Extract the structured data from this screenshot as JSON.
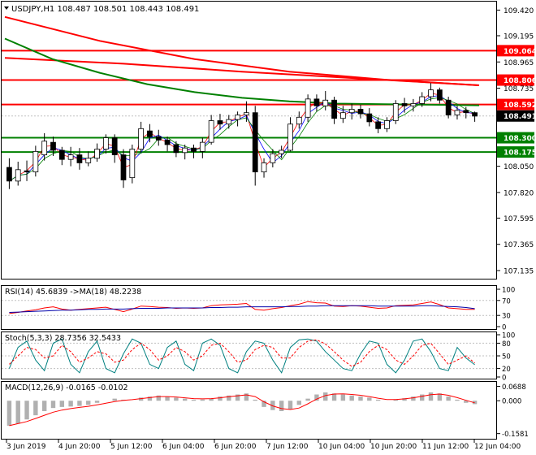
{
  "chart_data": {
    "type": "candlestick",
    "symbol_header": "USDJPY,H1  108.487 108.501 108.443 108.491",
    "ohlc_open": 108.487,
    "ohlc_high": 108.501,
    "ohlc_low": 108.443,
    "ohlc_close": 108.491,
    "current_price": "108.491",
    "x_tick_labels": [
      "3 Jun 2019",
      "4 Jun 20:00",
      "5 Jun 12:00",
      "6 Jun 04:00",
      "6 Jun 20:00",
      "7 Jun 12:00",
      "10 Jun 04:00",
      "10 Jun 20:00",
      "11 Jun 12:00",
      "12 Jun 04:00"
    ],
    "main": {
      "ylim": [
        107.085,
        109.48
      ],
      "y_ticks": [
        "109.420",
        "109.195",
        "108.965",
        "108.735",
        "108.510",
        "108.280",
        "108.050",
        "107.820",
        "107.595",
        "107.365",
        "107.135"
      ],
      "levels": [
        {
          "price": 109.064,
          "label": "109.064",
          "color": "#ff0000"
        },
        {
          "price": 108.806,
          "label": "108.806",
          "color": "#ff0000"
        },
        {
          "price": 108.592,
          "label": "108.592",
          "color": "#ff0000"
        },
        {
          "price": 108.3,
          "label": "108.300",
          "color": "#008000"
        },
        {
          "price": 108.175,
          "label": "108.175",
          "color": "#008000"
        }
      ],
      "trend_lines": [
        {
          "name": "red-ma-upper",
          "color": "#ff0000",
          "x": [
            0,
            0.2,
            0.4,
            0.6,
            0.8,
            1.0
          ],
          "y": [
            109.36,
            109.15,
            108.99,
            108.88,
            108.81,
            108.76
          ]
        },
        {
          "name": "red-ma-lower",
          "color": "#ff0000",
          "x": [
            0,
            0.25,
            0.5,
            0.75,
            1.0
          ],
          "y": [
            109.0,
            108.95,
            108.88,
            108.82,
            108.76
          ]
        },
        {
          "name": "green-ma",
          "color": "#008000",
          "x": [
            0,
            0.1,
            0.2,
            0.3,
            0.4,
            0.5,
            0.6,
            0.7,
            0.8,
            0.9,
            1.0
          ],
          "y": [
            109.17,
            108.99,
            108.87,
            108.77,
            108.7,
            108.65,
            108.62,
            108.6,
            108.595,
            108.59,
            108.585
          ]
        }
      ],
      "candles_ohlc": [
        [
          108.04,
          108.12,
          107.85,
          107.92
        ],
        [
          107.92,
          108.09,
          107.88,
          108.02
        ],
        [
          108.01,
          108.1,
          107.92,
          108.0
        ],
        [
          108.0,
          108.23,
          107.96,
          108.18
        ],
        [
          108.15,
          108.34,
          108.1,
          108.27
        ],
        [
          108.26,
          108.31,
          108.14,
          108.19
        ],
        [
          108.19,
          108.22,
          108.06,
          108.11
        ],
        [
          108.11,
          108.22,
          108.05,
          108.15
        ],
        [
          108.15,
          108.21,
          108.02,
          108.08
        ],
        [
          108.08,
          108.18,
          108.05,
          108.12
        ],
        [
          108.12,
          108.25,
          108.09,
          108.2
        ],
        [
          108.2,
          108.33,
          108.16,
          108.3
        ],
        [
          108.3,
          108.33,
          108.08,
          108.15
        ],
        [
          108.15,
          108.2,
          107.86,
          107.93
        ],
        [
          107.95,
          108.24,
          107.9,
          108.2
        ],
        [
          108.2,
          108.44,
          108.17,
          108.38
        ],
        [
          108.36,
          108.42,
          108.26,
          108.31
        ],
        [
          108.31,
          108.37,
          108.23,
          108.28
        ],
        [
          108.28,
          108.31,
          108.18,
          108.24
        ],
        [
          108.24,
          108.27,
          108.13,
          108.17
        ],
        [
          108.17,
          108.24,
          108.11,
          108.21
        ],
        [
          108.21,
          108.24,
          108.12,
          108.18
        ],
        [
          108.18,
          108.3,
          108.12,
          108.26
        ],
        [
          108.26,
          108.5,
          108.24,
          108.45
        ],
        [
          108.45,
          108.51,
          108.37,
          108.42
        ],
        [
          108.42,
          108.5,
          108.38,
          108.46
        ],
        [
          108.46,
          108.53,
          108.4,
          108.5
        ],
        [
          108.5,
          108.62,
          108.44,
          108.52
        ],
        [
          108.52,
          108.58,
          107.88,
          108.0
        ],
        [
          108.0,
          108.12,
          107.95,
          108.08
        ],
        [
          108.08,
          108.2,
          108.04,
          108.16
        ],
        [
          108.16,
          108.23,
          108.12,
          108.19
        ],
        [
          108.19,
          108.48,
          108.18,
          108.42
        ],
        [
          108.42,
          108.53,
          108.38,
          108.48
        ],
        [
          108.48,
          108.68,
          108.44,
          108.64
        ],
        [
          108.64,
          108.68,
          108.53,
          108.58
        ],
        [
          108.58,
          108.71,
          108.54,
          108.63
        ],
        [
          108.63,
          108.66,
          108.42,
          108.47
        ],
        [
          108.47,
          108.58,
          108.43,
          108.52
        ],
        [
          108.52,
          108.6,
          108.46,
          108.55
        ],
        [
          108.55,
          108.59,
          108.47,
          108.51
        ],
        [
          108.51,
          108.56,
          108.4,
          108.44
        ],
        [
          108.44,
          108.48,
          108.34,
          108.38
        ],
        [
          108.38,
          108.48,
          108.35,
          108.45
        ],
        [
          108.45,
          108.63,
          108.42,
          108.6
        ],
        [
          108.6,
          108.65,
          108.52,
          108.58
        ],
        [
          108.58,
          108.64,
          108.53,
          108.6
        ],
        [
          108.6,
          108.7,
          108.57,
          108.66
        ],
        [
          108.66,
          108.78,
          108.62,
          108.72
        ],
        [
          108.72,
          108.74,
          108.6,
          108.63
        ],
        [
          108.63,
          108.66,
          108.47,
          108.5
        ],
        [
          108.5,
          108.58,
          108.46,
          108.54
        ],
        [
          108.54,
          108.57,
          108.47,
          108.52
        ],
        [
          108.52,
          108.53,
          108.44,
          108.49
        ]
      ]
    },
    "rsi": {
      "label": "RSI(14) 45.6839  ->MA(18) 48.2238",
      "ylim": [
        0,
        100
      ],
      "y_ticks": [
        "100",
        "70",
        "30",
        "0"
      ],
      "rsi_values": [
        35,
        38,
        42,
        45,
        50,
        53,
        47,
        44,
        46,
        48,
        50,
        52,
        46,
        40,
        47,
        55,
        54,
        52,
        51,
        49,
        50,
        49,
        50,
        56,
        58,
        59,
        60,
        62,
        46,
        44,
        48,
        51,
        56,
        60,
        67,
        64,
        63,
        55,
        54,
        56,
        55,
        52,
        49,
        50,
        56,
        57,
        58,
        62,
        66,
        59,
        50,
        48,
        46,
        46
      ],
      "ma_values": [
        38,
        39,
        40,
        41,
        42,
        43,
        44,
        44,
        45,
        46,
        46,
        47,
        47,
        47,
        48,
        49,
        49,
        49,
        50,
        50,
        50,
        50,
        50,
        51,
        51,
        52,
        52,
        53,
        53,
        53,
        53,
        53,
        54,
        54,
        55,
        55,
        56,
        56,
        56,
        56,
        56,
        56,
        55,
        55,
        55,
        55,
        55,
        56,
        56,
        55,
        54,
        53,
        51,
        48
      ]
    },
    "stochastic": {
      "label": "Stoch(5,3,3) 28.7356 32.5433",
      "ylim": [
        0,
        100
      ],
      "y_ticks": [
        "100",
        "80",
        "50",
        "20",
        "0"
      ],
      "k_values": [
        20,
        70,
        85,
        40,
        15,
        80,
        90,
        30,
        10,
        60,
        85,
        20,
        10,
        55,
        90,
        80,
        30,
        20,
        70,
        85,
        30,
        15,
        80,
        90,
        75,
        20,
        10,
        60,
        85,
        80,
        40,
        10,
        70,
        88,
        90,
        85,
        60,
        40,
        20,
        15,
        55,
        85,
        80,
        30,
        10,
        40,
        85,
        90,
        60,
        20,
        15,
        70,
        45,
        29
      ],
      "d_values": [
        30,
        50,
        70,
        65,
        45,
        50,
        75,
        60,
        35,
        45,
        60,
        55,
        35,
        40,
        65,
        80,
        65,
        40,
        50,
        70,
        60,
        40,
        50,
        75,
        80,
        60,
        35,
        40,
        65,
        75,
        70,
        45,
        45,
        70,
        85,
        88,
        78,
        60,
        40,
        25,
        35,
        60,
        75,
        65,
        40,
        30,
        50,
        75,
        80,
        55,
        30,
        40,
        50,
        33
      ]
    },
    "macd": {
      "label": "MACD(12,26,9) -0.0165 -0.0102",
      "ylim": [
        -0.175,
        0.075
      ],
      "y_ticks": [
        "0.0688",
        "0.000",
        "-0.1581"
      ],
      "histogram": [
        -0.12,
        -0.11,
        -0.09,
        -0.07,
        -0.05,
        -0.035,
        -0.03,
        -0.028,
        -0.025,
        -0.02,
        -0.01,
        0.0,
        0.01,
        0.005,
        0.0,
        0.015,
        0.02,
        0.025,
        0.02,
        0.015,
        0.01,
        0.005,
        0.006,
        0.01,
        0.02,
        0.025,
        0.03,
        0.035,
        0.005,
        -0.03,
        -0.045,
        -0.05,
        -0.04,
        -0.02,
        0.01,
        0.03,
        0.04,
        0.035,
        0.03,
        0.025,
        0.02,
        0.015,
        0.005,
        0.0,
        0.005,
        0.012,
        0.02,
        0.03,
        0.04,
        0.035,
        0.02,
        0.005,
        -0.01,
        -0.0165
      ],
      "signal": [
        -0.12,
        -0.11,
        -0.1,
        -0.085,
        -0.07,
        -0.055,
        -0.045,
        -0.038,
        -0.032,
        -0.027,
        -0.02,
        -0.012,
        -0.004,
        0.002,
        0.005,
        0.01,
        0.015,
        0.02,
        0.02,
        0.018,
        0.014,
        0.01,
        0.009,
        0.01,
        0.014,
        0.019,
        0.024,
        0.028,
        0.02,
        -0.005,
        -0.025,
        -0.038,
        -0.042,
        -0.035,
        -0.015,
        0.008,
        0.025,
        0.032,
        0.033,
        0.03,
        0.026,
        0.02,
        0.012,
        0.006,
        0.006,
        0.009,
        0.014,
        0.021,
        0.029,
        0.032,
        0.026,
        0.015,
        0.002,
        -0.0102
      ]
    }
  }
}
